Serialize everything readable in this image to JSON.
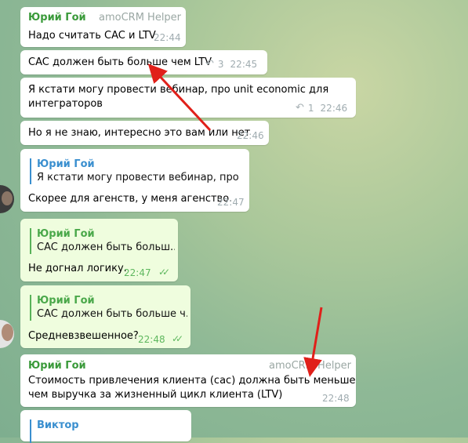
{
  "messages": [
    {
      "sender": "Юрий Гой",
      "tag": "amoCRM Helper",
      "text": "Надо считать CAC и LTV",
      "time": "22:44"
    },
    {
      "text": "CAC должен быть больше чем LTV",
      "replies": "3",
      "time": "22:45"
    },
    {
      "text_line1": "Я кстати могу провести вебинар, про unit economic для",
      "text_line2": "интеграторов",
      "replies": "1",
      "time": "22:46"
    },
    {
      "text": "Но я не знаю, интересно это вам или нет",
      "time": "22:46"
    },
    {
      "quote_name": "Юрий Гой",
      "quote_text": "Я кстати могу провести вебинар, про u...",
      "text": "Скорее для агенств, у меня агенство.",
      "time": "22:47"
    },
    {
      "quote_name": "Юрий Гой",
      "quote_text": "CAC должен быть больш...",
      "text": "Не догнал логику.",
      "time": "22:47"
    },
    {
      "quote_name": "Юрий Гой",
      "quote_text": "CAC должен быть больше ч...",
      "text": "Средневзвешенное?",
      "time": "22:48"
    },
    {
      "sender": "Юрий Гой",
      "tag": "amoCRM Helper",
      "text_line1": "Стоимость привлечения клиента (сас) должна быть меньше",
      "text_line2": "чем выручка за жизненный цикл клиента (LTV)",
      "time": "22:48"
    },
    {
      "sender": "Виктор"
    }
  ],
  "colors": {
    "arrow": "#e0201a",
    "sender": "#3a9a3a",
    "quote_bar": "#3a8fcf",
    "outgoing_bg": "#effdde"
  }
}
